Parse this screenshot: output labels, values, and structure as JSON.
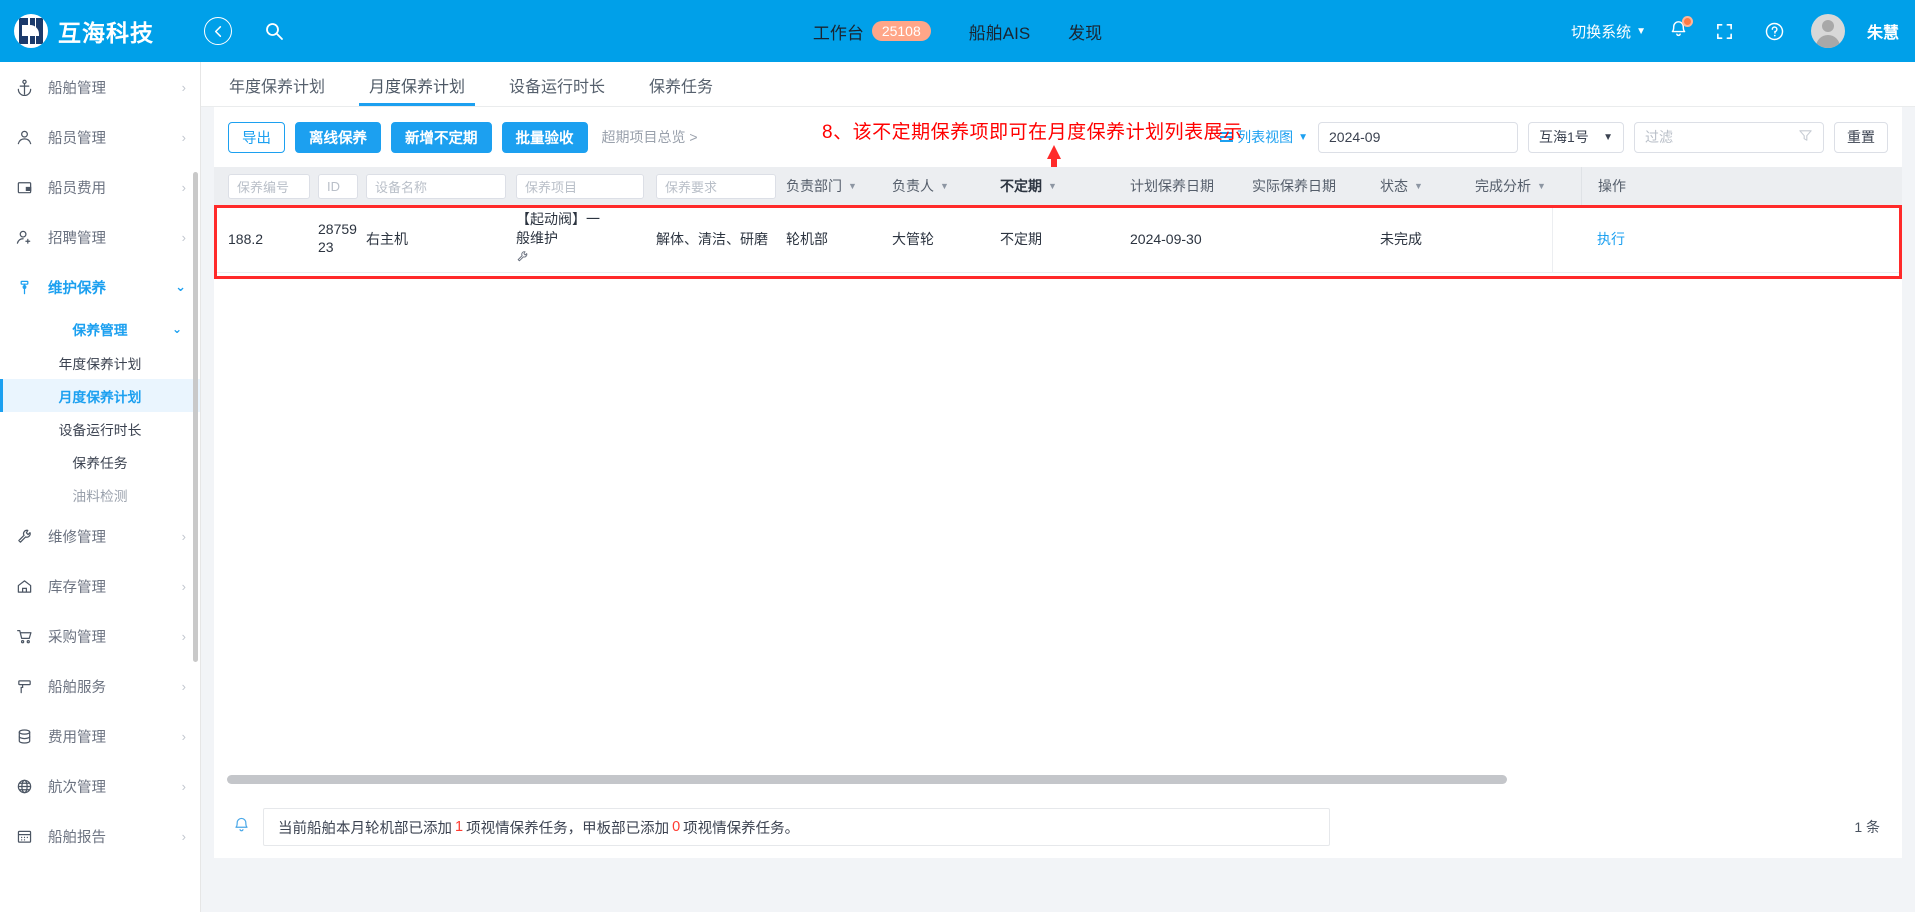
{
  "header": {
    "brand": "互海科技",
    "back_icon": "back-arrow-icon",
    "search_icon": "search-icon",
    "nav": [
      {
        "label": "工作台",
        "badge": "25108"
      },
      {
        "label": "船舶AIS"
      },
      {
        "label": "发现"
      }
    ],
    "switch_system": "切换系统",
    "user_name": "朱慧",
    "fullscreen_icon": "fullscreen-icon",
    "help_icon": "help-icon",
    "bell_icon": "bell-icon"
  },
  "sidebar": {
    "items": [
      {
        "label": "船舶管理",
        "icon": "anchor-icon"
      },
      {
        "label": "船员管理",
        "icon": "person-icon"
      },
      {
        "label": "船员费用",
        "icon": "wallet-icon"
      },
      {
        "label": "招聘管理",
        "icon": "person-add-icon"
      },
      {
        "label": "维护保养",
        "icon": "maintenance-icon"
      }
    ],
    "group": "保养管理",
    "sub_items": [
      {
        "label": "年度保养计划"
      },
      {
        "label": "月度保养计划"
      },
      {
        "label": "设备运行时长"
      },
      {
        "label": "保养任务"
      },
      {
        "label": "油料检测"
      }
    ],
    "items_after": [
      {
        "label": "维修管理",
        "icon": "wrench-icon"
      },
      {
        "label": "库存管理",
        "icon": "home-icon"
      },
      {
        "label": "采购管理",
        "icon": "cart-icon"
      },
      {
        "label": "船舶服务",
        "icon": "service-icon"
      },
      {
        "label": "费用管理",
        "icon": "database-icon"
      },
      {
        "label": "航次管理",
        "icon": "globe-icon"
      },
      {
        "label": "船舶报告",
        "icon": "calendar-icon"
      }
    ]
  },
  "tabs": [
    {
      "label": "年度保养计划"
    },
    {
      "label": "月度保养计划"
    },
    {
      "label": "设备运行时长"
    },
    {
      "label": "保养任务"
    }
  ],
  "toolbar": {
    "export": "导出",
    "offline": "离线保养",
    "add_irregular": "新增不定期",
    "batch_accept": "批量验收",
    "overdue_link": "超期项目总览 >",
    "list_view": "列表视图",
    "month_value": "2024-09",
    "ship_value": "互海1号",
    "filter_placeholder": "过滤",
    "reset": "重置",
    "filter_icon": "funnel-icon"
  },
  "annotation": {
    "text": "8、该不定期保养项即可在月度保养计划列表展示"
  },
  "table": {
    "filters": {
      "code": "保养编号",
      "id": "ID",
      "device": "设备名称",
      "item": "保养项目",
      "req": "保养要求"
    },
    "headers": [
      {
        "label": "负责部门",
        "sortable": true
      },
      {
        "label": "负责人",
        "sortable": true
      },
      {
        "label": "不定期",
        "sortable": true,
        "strong": true
      },
      {
        "label": "计划保养日期",
        "sortable": false
      },
      {
        "label": "实际保养日期",
        "sortable": false
      },
      {
        "label": "状态",
        "sortable": true
      },
      {
        "label": "完成分析",
        "sortable": true
      },
      {
        "label": "操作",
        "sortable": false
      }
    ],
    "rows": [
      {
        "code": "188.2",
        "id": "2875923",
        "device": "右主机",
        "item": "【起动阀】一般维护",
        "item_icon": "wrench-icon",
        "req": "解体、清洁、研磨",
        "dept": "轮机部",
        "person": "大管轮",
        "irregular": "不定期",
        "plan_date": "2024-09-30",
        "actual_date": "",
        "status": "未完成",
        "analysis": "",
        "action": "执行"
      }
    ]
  },
  "footer": {
    "notice_prefix": "当前船舶本月轮机部已添加",
    "notice_num1": "1",
    "notice_mid": "项视情保养任务，甲板部已添加",
    "notice_num2": "0",
    "notice_suffix": "项视情保养任务。",
    "count": "1 条",
    "bell_icon": "bell-icon"
  }
}
